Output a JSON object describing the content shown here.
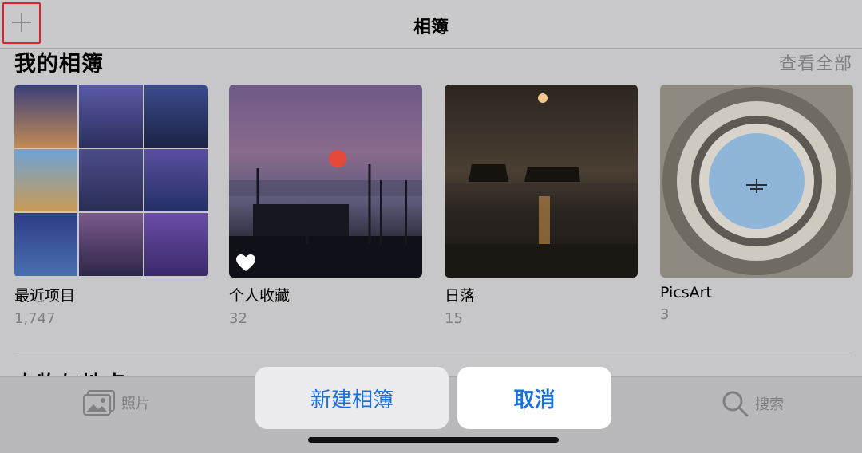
{
  "header": {
    "title": "相簿",
    "add_icon": "plus-icon"
  },
  "my_albums": {
    "title": "我的相簿",
    "see_all": "查看全部",
    "albums": [
      {
        "name": "最近项目",
        "count": "1,747"
      },
      {
        "name": "个人收藏",
        "count": "32"
      },
      {
        "name": "日落",
        "count": "15"
      },
      {
        "name": "PicsArt",
        "count": "3"
      }
    ]
  },
  "next_section": {
    "title": "人物与地点"
  },
  "tabbar": {
    "photos": {
      "label": "照片",
      "icon": "photos-icon"
    },
    "search": {
      "label": "搜索",
      "icon": "search-icon"
    }
  },
  "action_sheet": {
    "new_album": "新建相簿",
    "cancel": "取消"
  },
  "colors": {
    "accent": "#1a6fd9",
    "highlight": "#e4202a"
  }
}
